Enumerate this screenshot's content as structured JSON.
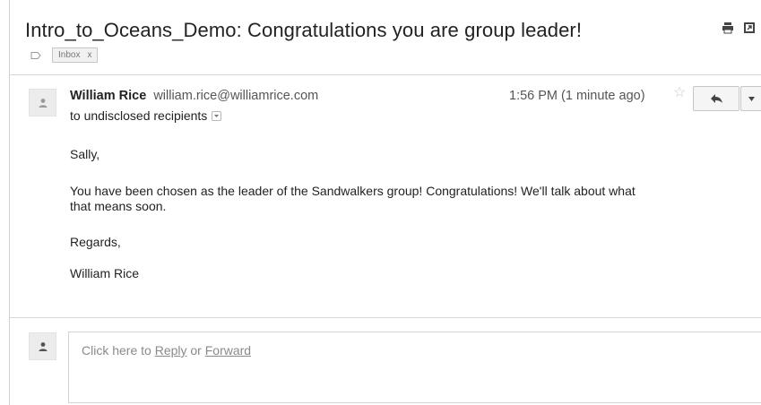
{
  "subject": "Intro_to_Oceans_Demo: Congratulations you are group leader!",
  "labels": [
    {
      "name": "Inbox",
      "remove": "x"
    }
  ],
  "toolbar_icons": [
    "print-icon",
    "new-window-icon"
  ],
  "message": {
    "sender_name": "William Rice",
    "sender_email": "william.rice@williamrice.com",
    "recipients": "to undisclosed recipients",
    "time": "1:56 PM (1 minute ago)",
    "star": "☆",
    "body": {
      "greeting": "Sally,",
      "paragraph_line1": "You have been chosen as the leader of the Sandwalkers group! Congratulations! We'll talk about what",
      "paragraph_line2": "that means soon.",
      "closing": "Regards,",
      "signature": "William Rice"
    }
  },
  "reply_box": {
    "prefix": "Click here to ",
    "reply": "Reply",
    "middle": " or ",
    "forward": "Forward"
  },
  "colors": {
    "border": "#d0d0d0",
    "muted_text": "#8a8a8a",
    "badge_bg": "#f1f1f1"
  }
}
